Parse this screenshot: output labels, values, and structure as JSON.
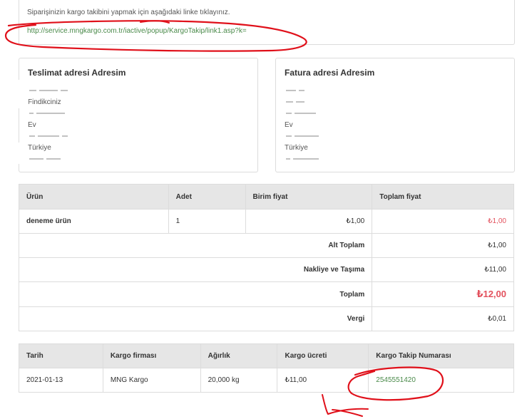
{
  "tracking": {
    "intro": "Siparişinizin kargo takibini yapmak için aşağıdaki linke tıklayınız.",
    "link": "http://service.mngkargo.com.tr/iactive/popup/KargoTakip/link1.asp?k="
  },
  "shipping_address": {
    "title": "Teslimat adresi Adresim",
    "lines": [
      "Findikciniz",
      "Ev",
      "Türkiye"
    ]
  },
  "billing_address": {
    "title": "Fatura adresi Adresim",
    "lines": [
      "Ev",
      "Türkiye"
    ]
  },
  "order_table": {
    "headers": [
      "Ürün",
      "Adet",
      "Birim fiyat",
      "Toplam fiyat"
    ],
    "item": {
      "name": "deneme ürün",
      "qty": "1",
      "unit_price": "₺1,00",
      "total": "₺1,00"
    },
    "summary": [
      {
        "label": "Alt Toplam",
        "value": "₺1,00"
      },
      {
        "label": "Nakliye ve Taşıma",
        "value": "₺11,00"
      },
      {
        "label": "Toplam",
        "value": "₺12,00"
      },
      {
        "label": "Vergi",
        "value": "₺0,01"
      }
    ]
  },
  "shipment_table": {
    "headers": [
      "Tarih",
      "Kargo firması",
      "Ağırlık",
      "Kargo ücreti",
      "Kargo Takip Numarası"
    ],
    "row": {
      "date": "2021-01-13",
      "carrier": "MNG Kargo",
      "weight": "20,000 kg",
      "fee": "₺11,00",
      "tracking_no": "2545551420"
    }
  },
  "colors": {
    "accent_red": "#e3525e",
    "link_green": "#4a8a4a",
    "annotation_red": "#e0101a"
  }
}
